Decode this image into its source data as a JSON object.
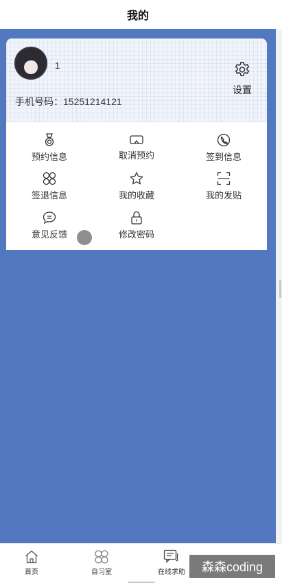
{
  "header": {
    "title": "我的"
  },
  "profile": {
    "username": "1",
    "phone_label": "手机号码：15251214121",
    "settings_label": "设置"
  },
  "menu": {
    "items": [
      {
        "label": "预约信息",
        "icon": "medal-icon"
      },
      {
        "label": "取消预约",
        "icon": "vr-glasses-icon"
      },
      {
        "label": "签到信息",
        "icon": "phone-circle-icon"
      },
      {
        "label": "签退信息",
        "icon": "grid-circles-icon"
      },
      {
        "label": "我的收藏",
        "icon": "star-icon"
      },
      {
        "label": "我的发贴",
        "icon": "scan-icon"
      },
      {
        "label": "意见反馈",
        "icon": "chat-bubble-icon"
      },
      {
        "label": "修改密码",
        "icon": "lock-icon"
      }
    ]
  },
  "tabbar": {
    "tabs": [
      {
        "label": "首页",
        "icon": "home-icon"
      },
      {
        "label": "自习室",
        "icon": "clover-icon"
      },
      {
        "label": "在线求助",
        "icon": "chat-icon"
      }
    ]
  },
  "watermark": "森森coding",
  "colors": {
    "accent": "#5278c0",
    "page": "#ffffff"
  }
}
